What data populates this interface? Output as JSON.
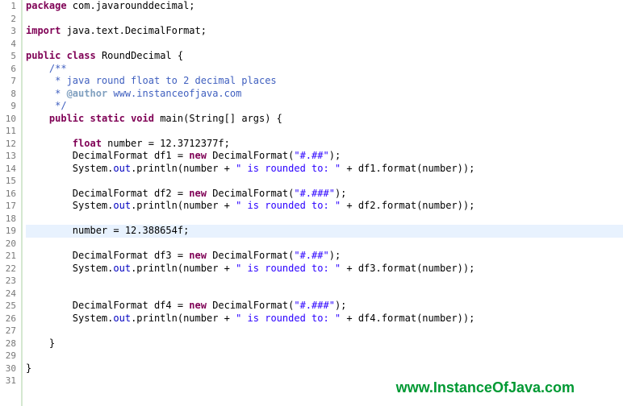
{
  "gutter": [
    "1",
    "2",
    "3",
    "4",
    "5",
    "6",
    "7",
    "8",
    "9",
    "10",
    "11",
    "12",
    "13",
    "14",
    "15",
    "16",
    "17",
    "18",
    "19",
    "20",
    "21",
    "22",
    "23",
    "24",
    "25",
    "26",
    "27",
    "28",
    "29",
    "30",
    "31"
  ],
  "code": {
    "l1_pkg": "package",
    "l1_rest": " com.javarounddecimal;",
    "l3_imp": "import",
    "l3_rest": " java.text.DecimalFormat;",
    "l5_pub": "public",
    "l5_cls": " class",
    "l5_rest": " RoundDecimal {",
    "l6": "    /**",
    "l7": "     * java round float to 2 decimal places",
    "l8a": "     * ",
    "l8tag": "@author",
    "l8b": " www.instanceofjava.com",
    "l9": "     */",
    "l10_ind": "    ",
    "l10_pub": "public",
    "l10_sta": " static",
    "l10_void": " void",
    "l10_rest": " main(String[] args) {",
    "l12_ind": "        ",
    "l12_flt": "float",
    "l12_rest": " number = 12.3712377f;",
    "l13_ind": "        DecimalFormat df1 = ",
    "l13_new": "new",
    "l13_mid": " DecimalFormat(",
    "l13_str": "\"#.##\"",
    "l13_end": ");",
    "l14_ind": "        System.",
    "l14_out": "out",
    "l14_mid": ".println(number + ",
    "l14_str": "\" is rounded to: \"",
    "l14_end": " + df1.format(number));",
    "l16_ind": "        DecimalFormat df2 = ",
    "l16_new": "new",
    "l16_mid": " DecimalFormat(",
    "l16_str": "\"#.###\"",
    "l16_end": ");",
    "l17_ind": "        System.",
    "l17_out": "out",
    "l17_mid": ".println(number + ",
    "l17_str": "\" is rounded to: \"",
    "l17_end": " + df2.format(number));",
    "l19": "        number = 12.388654f;",
    "l21_ind": "        DecimalFormat df3 = ",
    "l21_new": "new",
    "l21_mid": " DecimalFormat(",
    "l21_str": "\"#.##\"",
    "l21_end": ");",
    "l22_ind": "        System.",
    "l22_out": "out",
    "l22_mid": ".println(number + ",
    "l22_str": "\" is rounded to: \"",
    "l22_end": " + df3.format(number));",
    "l25_ind": "        DecimalFormat df4 = ",
    "l25_new": "new",
    "l25_mid": " DecimalFormat(",
    "l25_str": "\"#.###\"",
    "l25_end": ");",
    "l26_ind": "        System.",
    "l26_out": "out",
    "l26_mid": ".println(number + ",
    "l26_str": "\" is rounded to: \"",
    "l26_end": " + df4.format(number));",
    "l28": "    }",
    "l30": "}"
  },
  "watermark": "www.InstanceOfJava.com",
  "collapse6": "⊖",
  "collapse10": "⊖"
}
